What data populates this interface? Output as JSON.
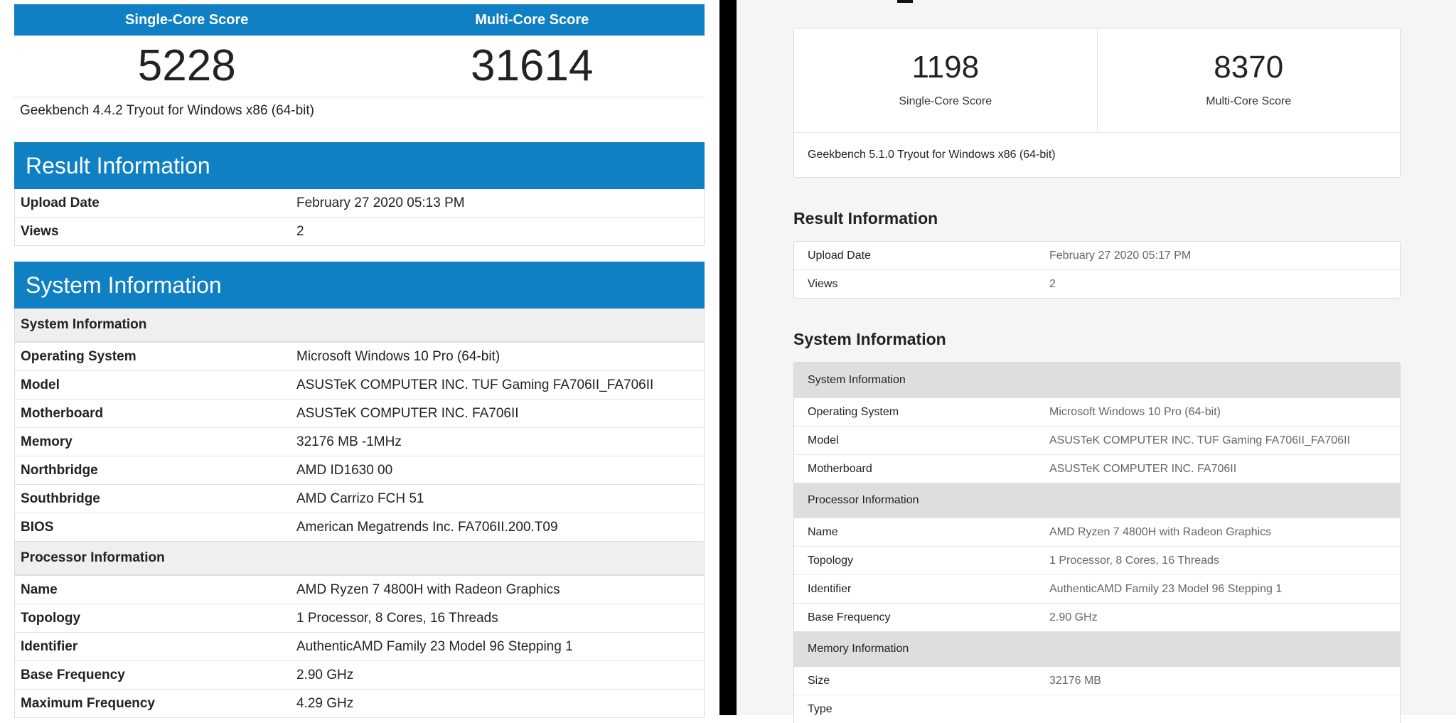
{
  "left": {
    "score_headers": {
      "single": "Single-Core Score",
      "multi": "Multi-Core Score"
    },
    "scores": {
      "single": "5228",
      "multi": "31614"
    },
    "version": "Geekbench 4.4.2 Tryout for Windows x86 (64-bit)",
    "result_title": "Result Information",
    "result_rows": [
      {
        "k": "Upload Date",
        "v": "February 27 2020 05:13 PM"
      },
      {
        "k": "Views",
        "v": "2"
      }
    ],
    "system_title": "System Information",
    "system_sub": "System Information",
    "system_rows": [
      {
        "k": "Operating System",
        "v": "Microsoft Windows 10 Pro (64-bit)"
      },
      {
        "k": "Model",
        "v": "ASUSTeK COMPUTER INC. TUF Gaming FA706II_FA706II"
      },
      {
        "k": "Motherboard",
        "v": "ASUSTeK COMPUTER INC. FA706II"
      },
      {
        "k": "Memory",
        "v": "32176 MB -1MHz"
      },
      {
        "k": "Northbridge",
        "v": "AMD ID1630 00"
      },
      {
        "k": "Southbridge",
        "v": "AMD Carrizo FCH 51"
      },
      {
        "k": "BIOS",
        "v": "American Megatrends Inc. FA706II.200.T09"
      }
    ],
    "processor_sub": "Processor Information",
    "processor_rows": [
      {
        "k": "Name",
        "v": "AMD Ryzen 7 4800H with Radeon Graphics"
      },
      {
        "k": "Topology",
        "v": "1 Processor, 8 Cores, 16 Threads"
      },
      {
        "k": "Identifier",
        "v": "AuthenticAMD Family 23 Model 96 Stepping 1"
      },
      {
        "k": "Base Frequency",
        "v": "2.90 GHz"
      },
      {
        "k": "Maximum Frequency",
        "v": "4.29 GHz"
      }
    ]
  },
  "right": {
    "scores": {
      "single": "1198",
      "multi": "8370"
    },
    "score_labels": {
      "single": "Single-Core Score",
      "multi": "Multi-Core Score"
    },
    "version": "Geekbench 5.1.0 Tryout for Windows x86 (64-bit)",
    "result_title": "Result Information",
    "result_rows": [
      {
        "k": "Upload Date",
        "v": "February 27 2020 05:17 PM"
      },
      {
        "k": "Views",
        "v": "2"
      }
    ],
    "system_title": "System Information",
    "system_sub": "System Information",
    "system_rows": [
      {
        "k": "Operating System",
        "v": "Microsoft Windows 10 Pro (64-bit)"
      },
      {
        "k": "Model",
        "v": "ASUSTeK COMPUTER INC. TUF Gaming FA706II_FA706II"
      },
      {
        "k": "Motherboard",
        "v": "ASUSTeK COMPUTER INC. FA706II"
      }
    ],
    "processor_sub": "Processor Information",
    "processor_rows": [
      {
        "k": "Name",
        "v": "AMD Ryzen 7 4800H with Radeon Graphics"
      },
      {
        "k": "Topology",
        "v": "1 Processor, 8 Cores, 16 Threads"
      },
      {
        "k": "Identifier",
        "v": "AuthenticAMD Family 23 Model 96 Stepping 1"
      },
      {
        "k": "Base Frequency",
        "v": "2.90 GHz"
      }
    ],
    "memory_sub": "Memory Information",
    "memory_rows": [
      {
        "k": "Size",
        "v": "32176 MB"
      },
      {
        "k": "Type",
        "v": ""
      }
    ]
  }
}
